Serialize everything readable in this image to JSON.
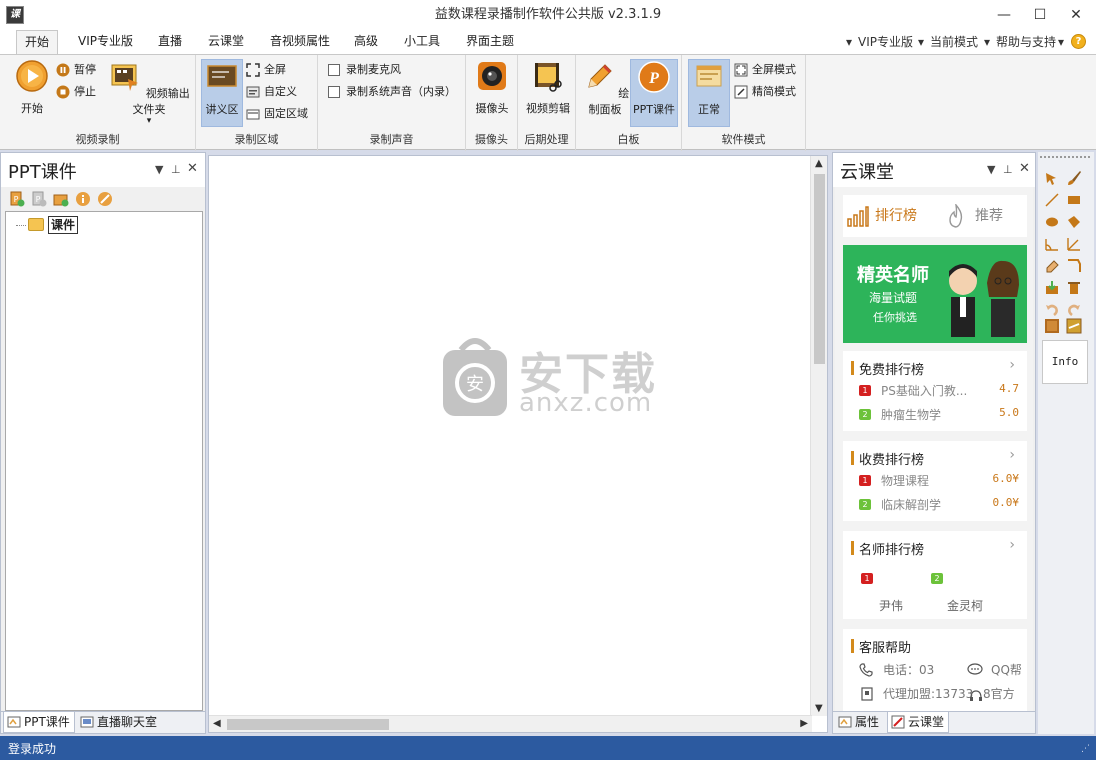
{
  "window": {
    "title": "益数课程录播制作软件公共版 v2.3.1.9",
    "icon_letter": "课",
    "minimize": "—",
    "maximize": "☐",
    "close": "✕"
  },
  "menu": {
    "tabs": [
      "开始",
      "VIP专业版",
      "直播",
      "云课堂",
      "音视频属性",
      "高级",
      "小工具",
      "界面主题"
    ],
    "active_tab": "开始",
    "right": [
      "VIP专业版",
      "当前模式",
      "帮助与支持"
    ],
    "help_icon": "?"
  },
  "ribbon": {
    "video_record": {
      "title": "视频录制",
      "start": "开始",
      "pause": "暂停",
      "stop": "停止",
      "output_folder": "视频输出文件夹"
    },
    "record_area": {
      "title": "录制区域",
      "lecture": "讲义区",
      "fullscreen": "全屏",
      "custom": "自定义",
      "fixed": "固定区域"
    },
    "record_audio": {
      "title": "录制声音",
      "mic": "录制麦克风",
      "system": "录制系统声音（内录）"
    },
    "camera": {
      "title": "摄像头",
      "label": "摄像头"
    },
    "post": {
      "title": "后期处理",
      "label": "视频剪辑"
    },
    "whiteboard": {
      "title": "白板",
      "draw": "绘制面板",
      "ppt": "PPT课件"
    },
    "mode": {
      "title": "软件模式",
      "normal": "正常",
      "full": "全屏模式",
      "simple": "精简模式"
    }
  },
  "left_panel": {
    "title": "PPT课件",
    "tree_root": "课件",
    "tabs": [
      "PPT课件",
      "直播聊天室"
    ]
  },
  "watermark": {
    "text": "安下载",
    "sub": "anxz.com"
  },
  "cloud": {
    "title": "云课堂",
    "rank_tab": "排行榜",
    "recommend_tab": "推荐",
    "banner": {
      "title": "精英名师",
      "sub": "海量试题",
      "sub2": "任你挑选"
    },
    "free_rank": {
      "title": "免费排行榜",
      "items": [
        {
          "rank": "1",
          "name": "PS基础入门教...",
          "value": "4.7"
        },
        {
          "rank": "2",
          "name": "肿瘤生物学",
          "value": "5.0"
        }
      ]
    },
    "paid_rank": {
      "title": "收费排行榜",
      "items": [
        {
          "rank": "1",
          "name": "物理课程",
          "value": "6.0¥"
        },
        {
          "rank": "2",
          "name": "临床解剖学",
          "value": "0.0¥"
        }
      ]
    },
    "teacher_rank": {
      "title": "名师排行榜",
      "items": [
        {
          "rank": "1",
          "name": "尹伟"
        },
        {
          "rank": "2",
          "name": "金灵柯"
        }
      ]
    },
    "support": {
      "title": "客服帮助",
      "phone": "电话：03",
      "qq": "QQ帮",
      "agent": "代理加盟:13733",
      "agent_tail": "8官方"
    },
    "tabs": [
      "属性",
      "云课堂"
    ]
  },
  "toolstrip": {
    "info": "Info"
  },
  "status": {
    "text": "登录成功"
  },
  "colors": {
    "accent": "#2c5aa0",
    "rank_red": "#d42020",
    "rank_green": "#6cc23a",
    "banner": "#2db45a",
    "orange": "#c9781a"
  }
}
